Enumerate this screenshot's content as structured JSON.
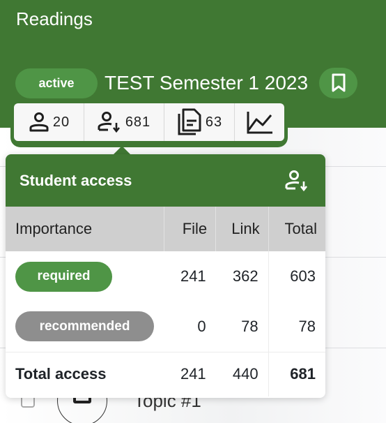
{
  "header": {
    "title": "Readings",
    "status_badge": "active",
    "course_name": "TEST Semester 1 2023",
    "bookmark_icon": "bookmark-icon",
    "colors": {
      "header_bg": "#407833",
      "badge_bg": "#4f9546"
    }
  },
  "stats": [
    {
      "icon": "person-icon",
      "value": "20"
    },
    {
      "icon": "person-download-icon",
      "value": "681"
    },
    {
      "icon": "files-icon",
      "value": "63"
    },
    {
      "icon": "line-chart-icon",
      "value": ""
    }
  ],
  "popup": {
    "title": "Student access",
    "header_icon": "person-download-icon",
    "columns": [
      "Importance",
      "File",
      "Link",
      "Total"
    ],
    "rows": [
      {
        "importance": "required",
        "color": "#4f9546",
        "file": "241",
        "link": "362",
        "total": "603"
      },
      {
        "importance": "recommended",
        "color": "#8e8e8e",
        "file": "0",
        "link": "78",
        "total": "78"
      }
    ],
    "total_row": {
      "label": "Total access",
      "file": "241",
      "link": "440",
      "total": "681"
    }
  },
  "background": {
    "topic_label": "Topic #1"
  }
}
